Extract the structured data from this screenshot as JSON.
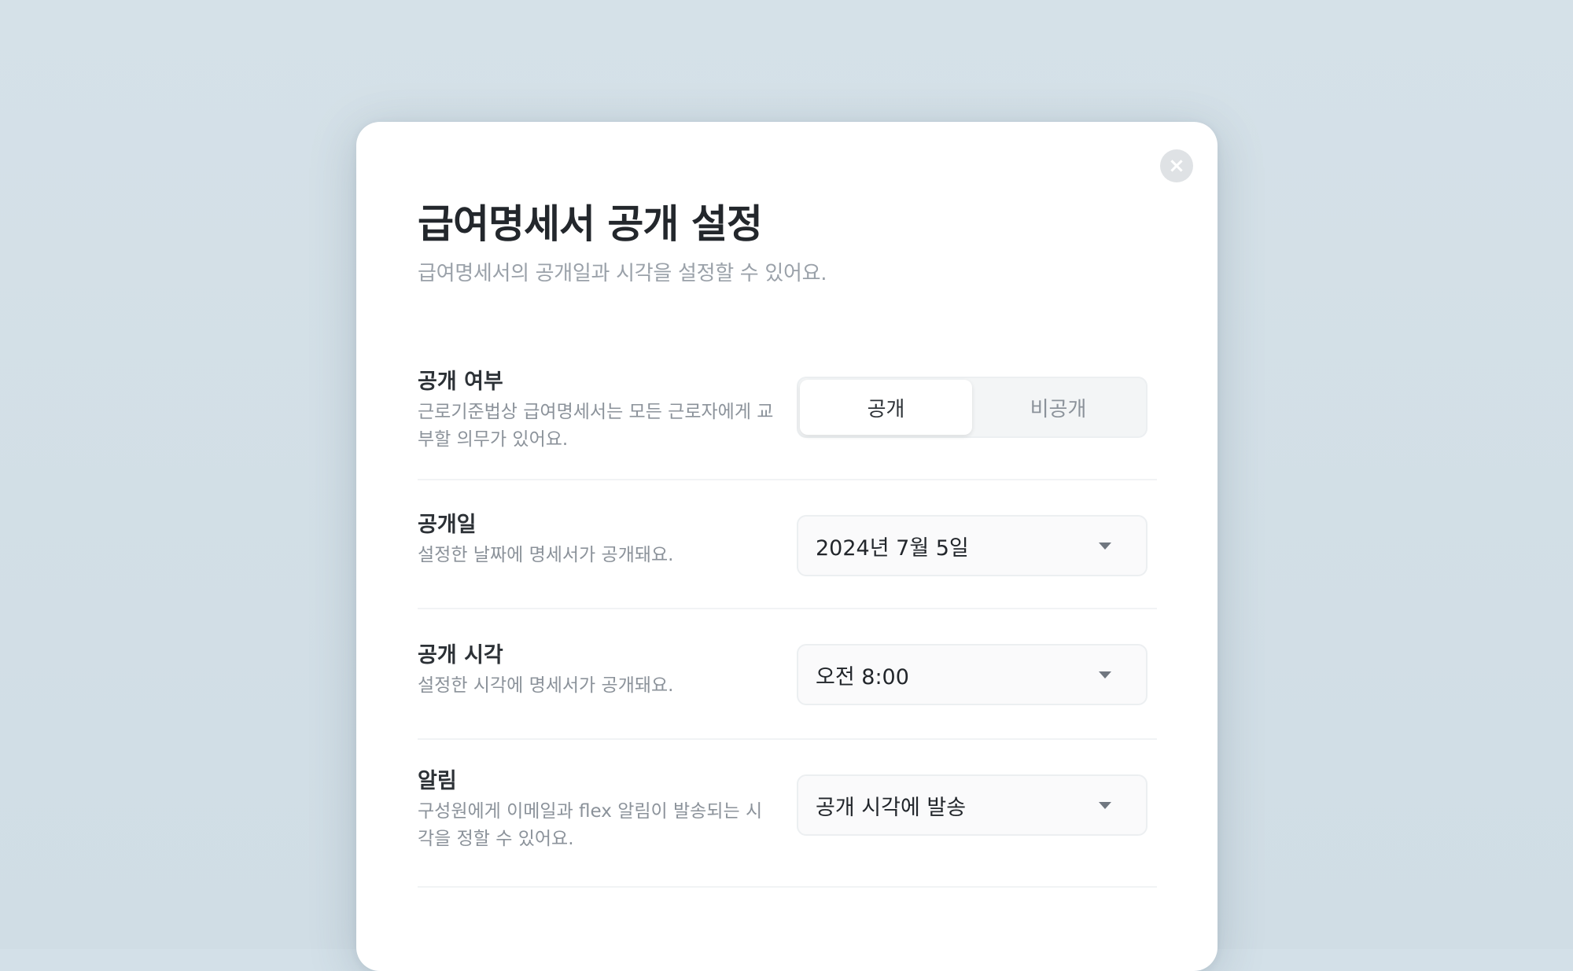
{
  "modal": {
    "title": "급여명세서 공개 설정",
    "subtitle": "급여명세서의 공개일과 시각을 설정할 수 있어요.",
    "close_icon": "×"
  },
  "rows": {
    "visibility": {
      "label": "공개 여부",
      "desc": "근로기준법상 급여명세서는 모든 근로자에게 교부할 의무가 있어요.",
      "options": [
        "공개",
        "비공개"
      ],
      "selected": "공개"
    },
    "date": {
      "label": "공개일",
      "desc": "설정한 날짜에 명세서가 공개돼요.",
      "value": "2024년 7월 5일"
    },
    "time": {
      "label": "공개 시각",
      "desc": "설정한 시각에 명세서가 공개돼요.",
      "value": "오전 8:00"
    },
    "notify": {
      "label": "알림",
      "desc": "구성원에게 이메일과 flex 알림이 발송되는 시각을 정할 수 있어요.",
      "value": "공개 시각에 발송"
    }
  }
}
